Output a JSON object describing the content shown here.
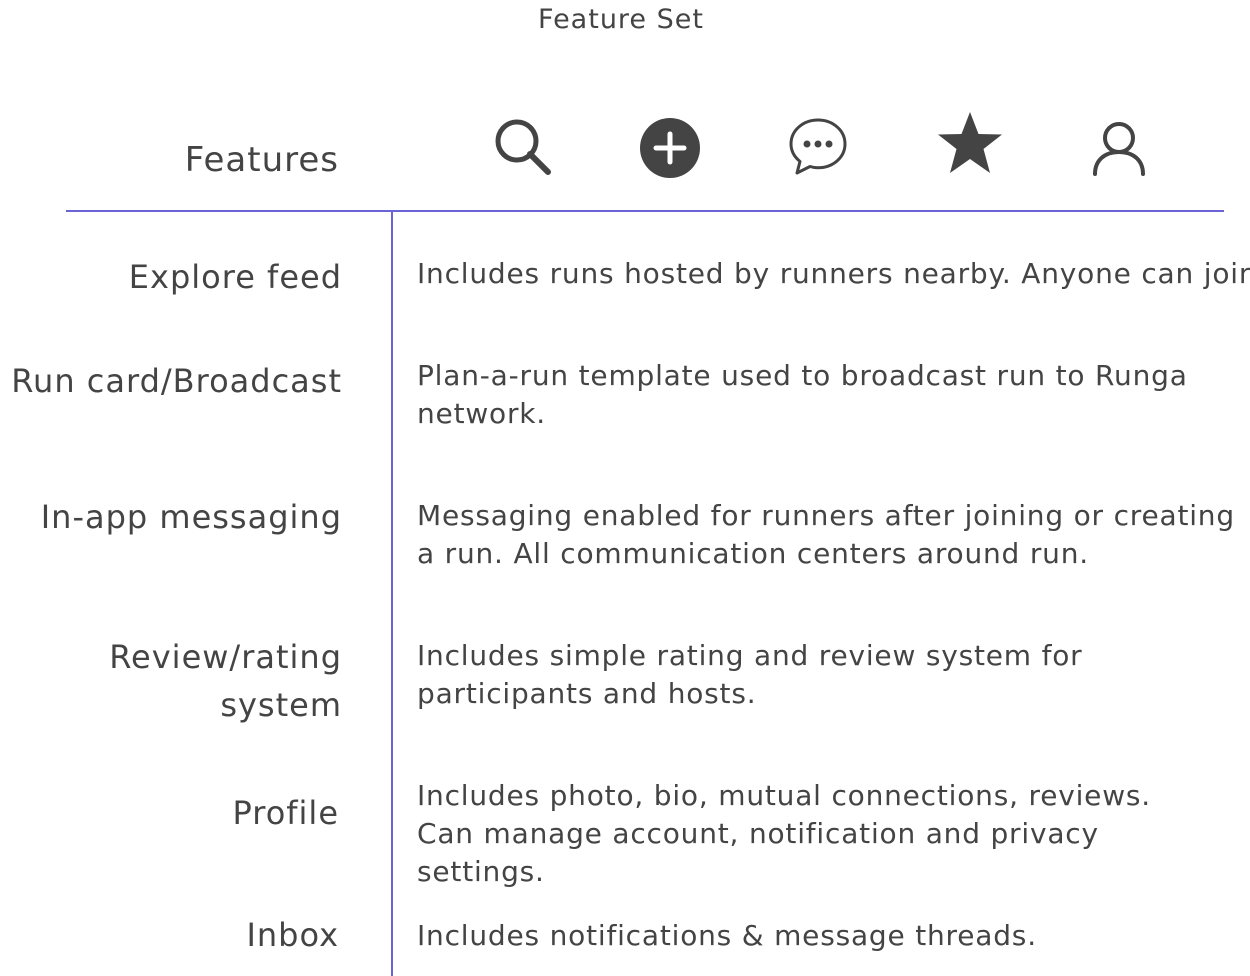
{
  "title": "Feature Set",
  "table": {
    "header_label": "Features",
    "icons": [
      {
        "name": "search-icon"
      },
      {
        "name": "add-circle-icon"
      },
      {
        "name": "chat-bubble-icon"
      },
      {
        "name": "star-icon"
      },
      {
        "name": "user-icon"
      }
    ],
    "rows": [
      {
        "feature": "Explore feed",
        "description": "Includes runs hosted by runners nearby. Anyone can join."
      },
      {
        "feature": "Run card/Broadcast",
        "description": "Plan-a-run template used to broadcast run to Runga network."
      },
      {
        "feature": "In-app messaging",
        "description": "Messaging enabled for runners after joining or creating a run. All communication centers around run."
      },
      {
        "feature": "Review/rating system",
        "description": "Includes simple rating and review system for participants and hosts."
      },
      {
        "feature": "Profile",
        "description": "Includes photo, bio, mutual connections, reviews. Can manage account, notification and privacy settings."
      },
      {
        "feature": "Inbox",
        "description": "Includes notifications & message threads."
      }
    ]
  },
  "colors": {
    "text": "#444444",
    "rule": "#6c63d6",
    "icon": "#444444"
  }
}
